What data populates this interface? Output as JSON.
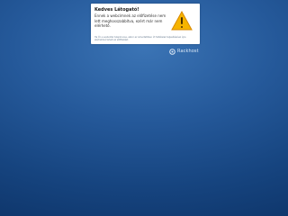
{
  "notice": {
    "title": "Kedves Látogató!",
    "message": "Ennek a webcímnek az előfizetése nem lett meghosszabbítva, ezért már nem elérhető.",
    "small_print": "Ha Ön a weboldal tulajdonosa, akkor az ismertetőben írt feltételek teljesítésével újra elérhetővé teheti az előfizetést."
  },
  "icons": {
    "notice": "warning-icon",
    "brand": "brand-logo-icon"
  },
  "brand": {
    "name": "Rackhost"
  },
  "colors": {
    "background": "#2a5d9e",
    "warning": "#f6b400",
    "card": "#ffffff"
  }
}
